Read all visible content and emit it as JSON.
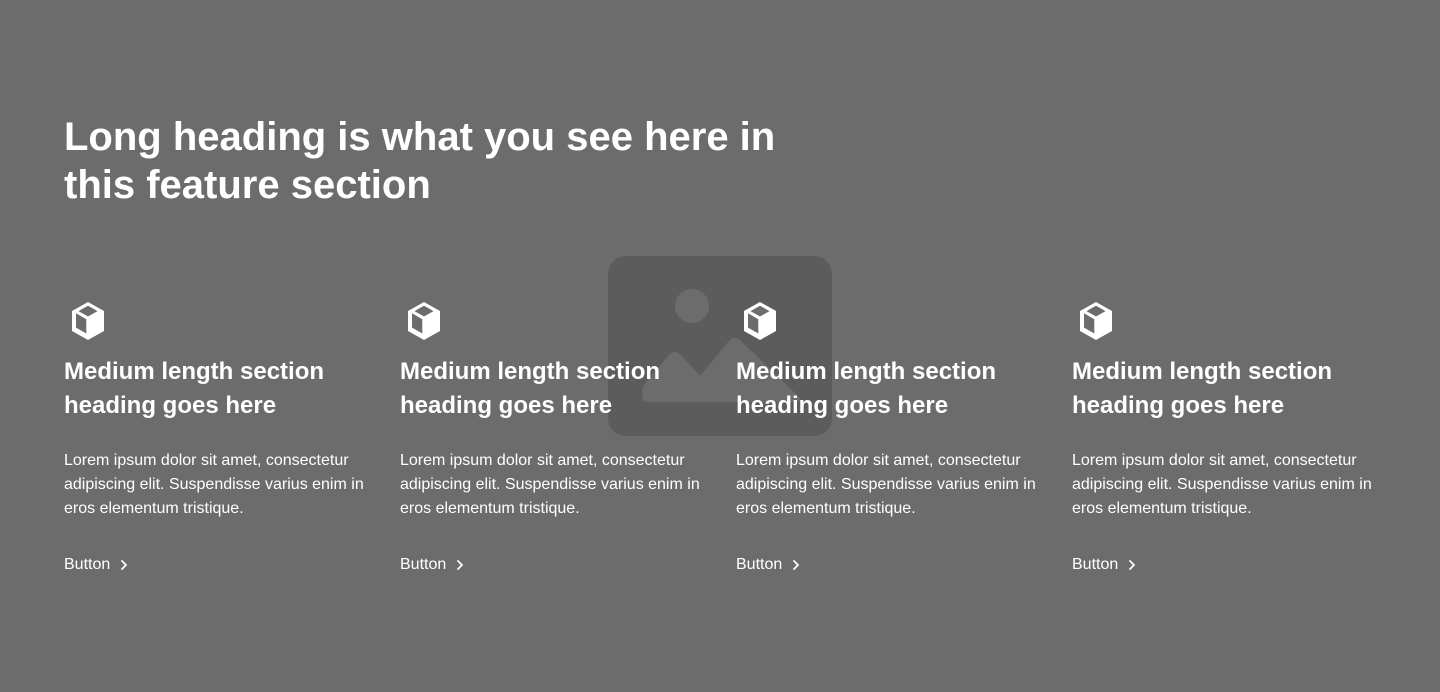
{
  "section": {
    "heading": "Long heading is what you see here in this feature section",
    "background_image_icon": "image-placeholder-icon"
  },
  "features": [
    {
      "icon": "cube-icon",
      "heading": "Medium length section heading goes here",
      "text": "Lorem ipsum dolor sit amet, consectetur adipiscing elit. Suspendisse varius enim in eros elementum tristique.",
      "button_label": "Button",
      "button_icon": "chevron-right-icon"
    },
    {
      "icon": "cube-icon",
      "heading": "Medium length section heading goes here",
      "text": "Lorem ipsum dolor sit amet, consectetur adipiscing elit. Suspendisse varius enim in eros elementum tristique.",
      "button_label": "Button",
      "button_icon": "chevron-right-icon"
    },
    {
      "icon": "cube-icon",
      "heading": "Medium length section heading goes here",
      "text": "Lorem ipsum dolor sit amet, consectetur adipiscing elit. Suspendisse varius enim in eros elementum tristique.",
      "button_label": "Button",
      "button_icon": "chevron-right-icon"
    },
    {
      "icon": "cube-icon",
      "heading": "Medium length section heading goes here",
      "text": "Lorem ipsum dolor sit amet, consectetur adipiscing elit. Suspendisse varius enim in eros elementum tristique.",
      "button_label": "Button",
      "button_icon": "chevron-right-icon"
    }
  ],
  "colors": {
    "background": "#6c6c6c",
    "text": "#ffffff",
    "placeholder": "#5c5c5c",
    "placeholder_shape": "#6c6c6c"
  }
}
